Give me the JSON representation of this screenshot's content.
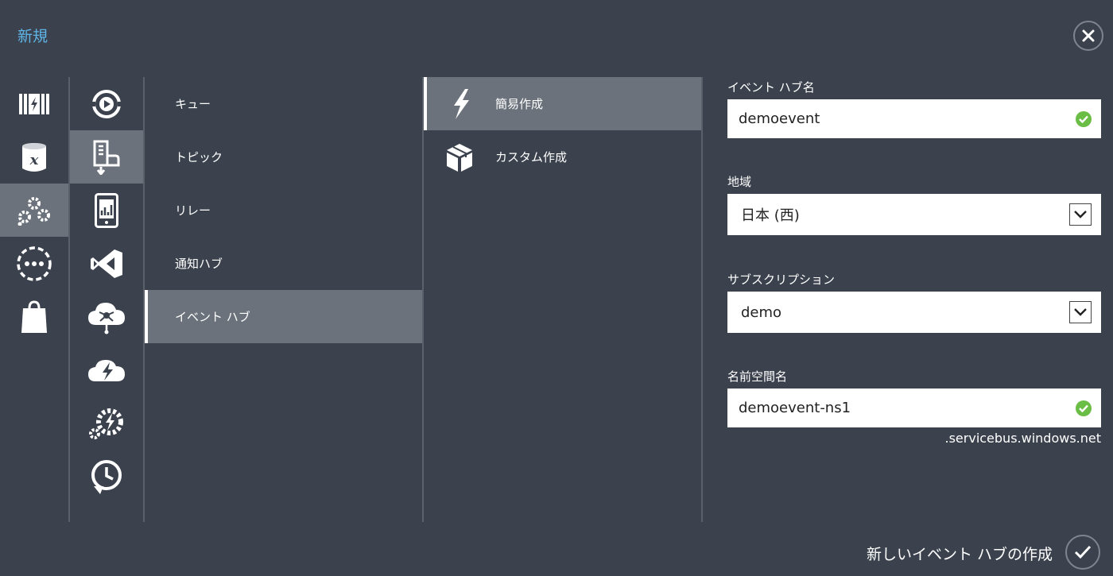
{
  "header": {
    "title": "新規",
    "close_icon": "close-icon"
  },
  "categories": [
    {
      "icon": "compute-icon",
      "selected": false
    },
    {
      "icon": "data-services-icon",
      "selected": false
    },
    {
      "icon": "app-services-icon",
      "selected": true
    },
    {
      "icon": "network-services-icon",
      "selected": false
    },
    {
      "icon": "store-icon",
      "selected": false
    }
  ],
  "services": [
    {
      "icon": "media-services-icon",
      "selected": false
    },
    {
      "icon": "service-bus-icon",
      "selected": true
    },
    {
      "icon": "mobile-services-icon",
      "selected": false
    },
    {
      "icon": "visual-studio-icon",
      "selected": false
    },
    {
      "icon": "cloud-network-icon",
      "selected": false
    },
    {
      "icon": "cloud-lightning-icon",
      "selected": false
    },
    {
      "icon": "automation-gear-icon",
      "selected": false
    },
    {
      "icon": "scheduler-icon",
      "selected": false
    }
  ],
  "types": [
    {
      "label": "キュー",
      "selected": false
    },
    {
      "label": "トピック",
      "selected": false
    },
    {
      "label": "リレー",
      "selected": false
    },
    {
      "label": "通知ハブ",
      "selected": false
    },
    {
      "label": "イベント ハブ",
      "selected": true
    }
  ],
  "methods": [
    {
      "label": "簡易作成",
      "icon": "lightning-icon",
      "selected": true
    },
    {
      "label": "カスタム作成",
      "icon": "box-icon",
      "selected": false
    }
  ],
  "form": {
    "event_hub_name": {
      "label": "イベント ハブ名",
      "value": "demoevent",
      "status": "valid"
    },
    "region": {
      "label": "地域",
      "value": "日本 (西)"
    },
    "subscription": {
      "label": "サブスクリプション",
      "value": "demo"
    },
    "namespace": {
      "label": "名前空間名",
      "value": "demoevent-ns1",
      "status": "valid",
      "suffix": ".servicebus.windows.net"
    }
  },
  "footer": {
    "create_label": "新しいイベント ハブの作成"
  },
  "colors": {
    "background": "#3b424d",
    "selected": "#6b727b",
    "accent": "#5fb4e8",
    "valid": "#6abd45"
  }
}
